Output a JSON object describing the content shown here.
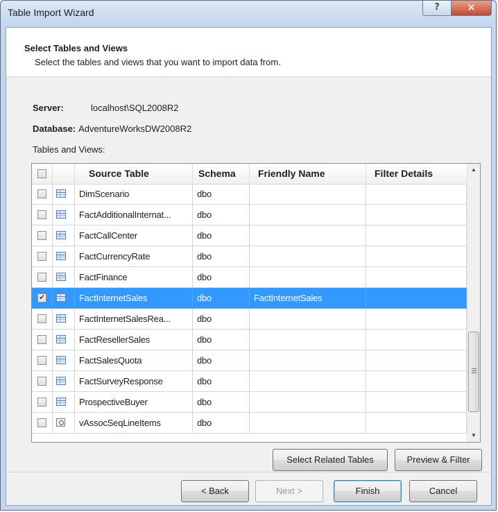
{
  "window": {
    "title": "Table Import Wizard",
    "help_glyph": "?",
    "close_glyph": "✕"
  },
  "header": {
    "title": "Select Tables and Views",
    "subtitle": "Select the tables and views that you want to import data from."
  },
  "info": {
    "server_label": "Server:",
    "server_value": "localhost\\SQL2008R2",
    "database_label": "Database:",
    "database_value": "AdventureWorksDW2008R2",
    "tables_label": "Tables and Views:"
  },
  "grid": {
    "columns": [
      "Source Table",
      "Schema",
      "Friendly Name",
      "Filter Details"
    ],
    "rows": [
      {
        "icon": "table-icon",
        "checked": false,
        "selected": false,
        "source": "DimScenario",
        "schema": "dbo",
        "friendly": "",
        "filter": ""
      },
      {
        "icon": "table-icon",
        "checked": false,
        "selected": false,
        "source": "FactAdditionalInternat...",
        "schema": "dbo",
        "friendly": "",
        "filter": ""
      },
      {
        "icon": "table-icon",
        "checked": false,
        "selected": false,
        "source": "FactCallCenter",
        "schema": "dbo",
        "friendly": "",
        "filter": ""
      },
      {
        "icon": "table-icon",
        "checked": false,
        "selected": false,
        "source": "FactCurrencyRate",
        "schema": "dbo",
        "friendly": "",
        "filter": ""
      },
      {
        "icon": "table-icon",
        "checked": false,
        "selected": false,
        "source": "FactFinance",
        "schema": "dbo",
        "friendly": "",
        "filter": ""
      },
      {
        "icon": "table-icon",
        "checked": true,
        "selected": true,
        "source": "FactInternetSales",
        "schema": "dbo",
        "friendly": "FactInternetSales",
        "filter": ""
      },
      {
        "icon": "table-icon",
        "checked": false,
        "selected": false,
        "source": "FactInternetSalesRea...",
        "schema": "dbo",
        "friendly": "",
        "filter": ""
      },
      {
        "icon": "table-icon",
        "checked": false,
        "selected": false,
        "source": "FactResellerSales",
        "schema": "dbo",
        "friendly": "",
        "filter": ""
      },
      {
        "icon": "table-icon",
        "checked": false,
        "selected": false,
        "source": "FactSalesQuota",
        "schema": "dbo",
        "friendly": "",
        "filter": ""
      },
      {
        "icon": "table-icon",
        "checked": false,
        "selected": false,
        "source": "FactSurveyResponse",
        "schema": "dbo",
        "friendly": "",
        "filter": ""
      },
      {
        "icon": "table-icon",
        "checked": false,
        "selected": false,
        "source": "ProspectiveBuyer",
        "schema": "dbo",
        "friendly": "",
        "filter": ""
      },
      {
        "icon": "view-icon",
        "checked": false,
        "selected": false,
        "source": "vAssocSeqLineItems",
        "schema": "dbo",
        "friendly": "",
        "filter": ""
      }
    ],
    "scroll_up_glyph": "▲",
    "scroll_down_glyph": "▼",
    "selection_color": "#3399ff"
  },
  "buttons": {
    "select_related": "Select Related Tables",
    "preview_filter": "Preview & Filter",
    "back": "< Back",
    "next": "Next >",
    "finish": "Finish",
    "cancel": "Cancel"
  }
}
